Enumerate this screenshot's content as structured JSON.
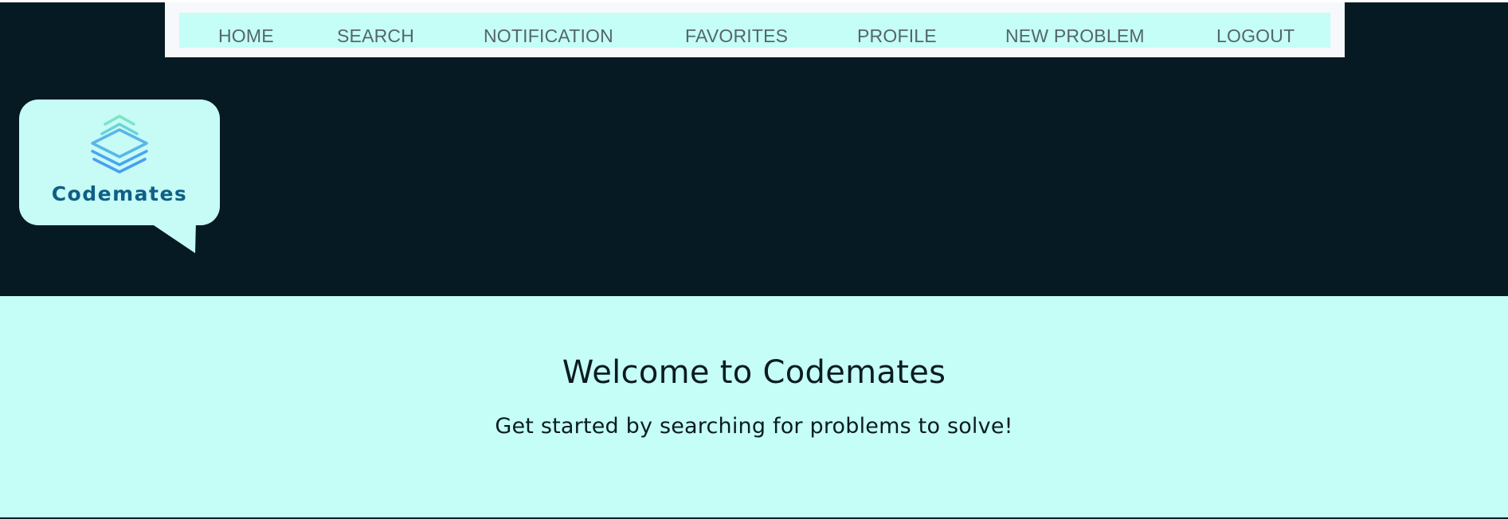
{
  "nav": {
    "items": [
      {
        "label": "HOME"
      },
      {
        "label": "SEARCH"
      },
      {
        "label": "NOTIFICATION"
      },
      {
        "label": "FAVORITES"
      },
      {
        "label": "PROFILE"
      },
      {
        "label": "NEW PROBLEM"
      },
      {
        "label": "LOGOUT"
      }
    ]
  },
  "logo": {
    "text": "Codemates",
    "icon": "stacked-layers-icon"
  },
  "hero": {
    "title": "Welcome to Codemates",
    "subtitle": "Get started by searching for problems to solve!"
  },
  "colors": {
    "header_background": "#061a23",
    "accent_cyan": "#c4fef6",
    "nav_text": "#55666b",
    "logo_text": "#0f5f86"
  }
}
